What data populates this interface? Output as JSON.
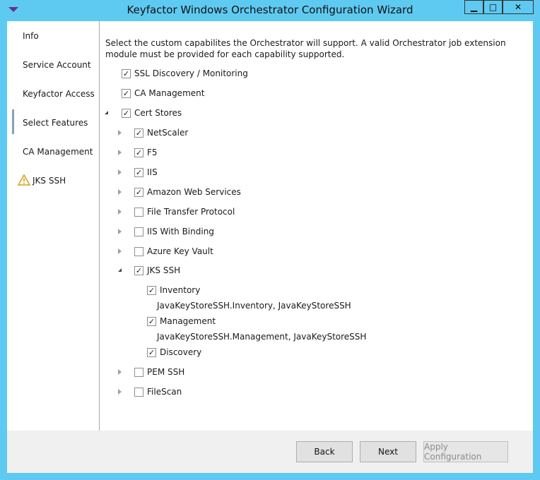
{
  "window": {
    "title": "Keyfactor Windows Orchestrator Configuration Wizard",
    "controls": {
      "minimize": "▁",
      "maximize": "□",
      "close": "✕"
    }
  },
  "sidebar": {
    "items": [
      {
        "label": "Info"
      },
      {
        "label": "Service Account"
      },
      {
        "label": "Keyfactor Access"
      },
      {
        "label": "Select Features",
        "selected": true
      },
      {
        "label": "CA Management"
      },
      {
        "label": "JKS SSH",
        "icon": "warning-icon"
      }
    ]
  },
  "main": {
    "description": "Select the custom capabilites the Orchestrator will support. A valid Orchestrator job extension module must be provided for each capability supported.",
    "features": {
      "ssl": {
        "label": "SSL Discovery / Monitoring",
        "checked": true
      },
      "ca_management": {
        "label": "CA Management",
        "checked": true
      },
      "cert_stores": {
        "label": "Cert Stores",
        "checked": true,
        "expanded": true
      },
      "stores": [
        {
          "label": "NetScaler",
          "checked": true
        },
        {
          "label": "F5",
          "checked": true
        },
        {
          "label": "IIS",
          "checked": true
        },
        {
          "label": "Amazon Web Services",
          "checked": true
        },
        {
          "label": "File Transfer Protocol",
          "checked": false
        },
        {
          "label": "IIS With Binding",
          "checked": false
        },
        {
          "label": "Azure Key Vault",
          "checked": false
        },
        {
          "label": "JKS SSH",
          "checked": true,
          "expanded": true
        },
        {
          "label": "PEM SSH",
          "checked": false
        },
        {
          "label": "FileScan",
          "checked": false
        }
      ],
      "jks_children": [
        {
          "label": "Inventory",
          "checked": true,
          "detail": "JavaKeyStoreSSH.Inventory, JavaKeyStoreSSH"
        },
        {
          "label": "Management",
          "checked": true,
          "detail": "JavaKeyStoreSSH.Management, JavaKeyStoreSSH"
        },
        {
          "label": "Discovery",
          "checked": true
        }
      ]
    }
  },
  "footer": {
    "back_label": "Back",
    "next_label": "Next",
    "apply_label": "Apply Configuration"
  },
  "check_glyph": "✓"
}
